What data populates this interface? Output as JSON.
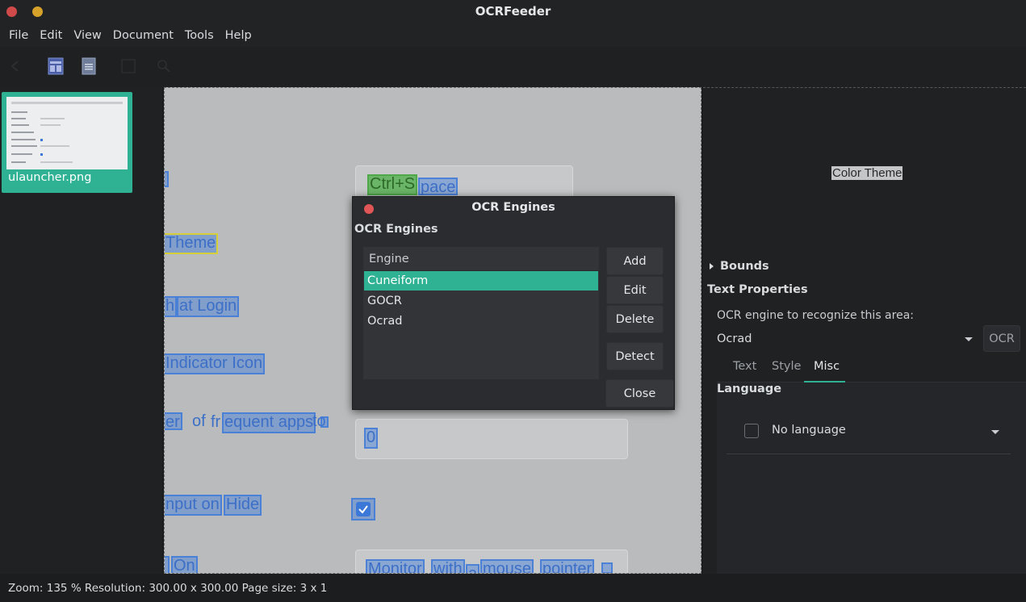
{
  "window": {
    "title": "OCRFeeder"
  },
  "menubar": {
    "items": [
      "File",
      "Edit",
      "View",
      "Document",
      "Tools",
      "Help"
    ]
  },
  "pages_pane": {
    "thumbnail_caption": "ulauncher.png"
  },
  "page": {
    "texts": {
      "ctrl": "Ctrl+S",
      "pace": "pace",
      "theme": "Theme",
      "h": "h",
      "at_login": "at Login",
      "indicator_icon": "Indicator Icon",
      "er": "er",
      "of": "of",
      "fr": "fr",
      "equent_apps": "equent apps",
      "to": "to",
      "zero": "0",
      "nput_on": "nput on",
      "hide": "Hide",
      "on": "On",
      "monitor": "Monitor",
      "with": "with",
      "a": "a",
      "mouse": "mouse",
      "pointer": "pointer"
    }
  },
  "right_panel": {
    "preview_text": "Color Theme",
    "bounds_label": "Bounds",
    "text_properties_title": "Text Properties",
    "ocr_engine_label": "OCR engine to recognize this area:",
    "ocr_engine_value": "Ocrad",
    "ocr_button": "OCR",
    "tabs": [
      "Text",
      "Style",
      "Misc"
    ],
    "active_tab": "Misc",
    "language_title": "Language",
    "language_value": "No language"
  },
  "statusbar": {
    "text": "Zoom: 135 % Resolution: 300.00 x 300.00 Page size: 3 x 1"
  },
  "dialog": {
    "title": "OCR Engines",
    "heading": "OCR Engines",
    "list_header": "Engine",
    "engines": [
      "Cuneiform",
      "GOCR",
      "Ocrad"
    ],
    "selected_engine": "Cuneiform",
    "buttons": {
      "add": "Add",
      "edit": "Edit",
      "delete": "Delete",
      "detect": "Detect",
      "close": "Close"
    }
  },
  "colors": {
    "accent": "#2fb293",
    "close_red": "#d04a4a",
    "minimize_yellow": "#d7a22a",
    "ocr_box_blue": "#3c78d7",
    "ocr_box_green": "#4fa84a",
    "ocr_box_yellow": "#d5cf3a"
  }
}
